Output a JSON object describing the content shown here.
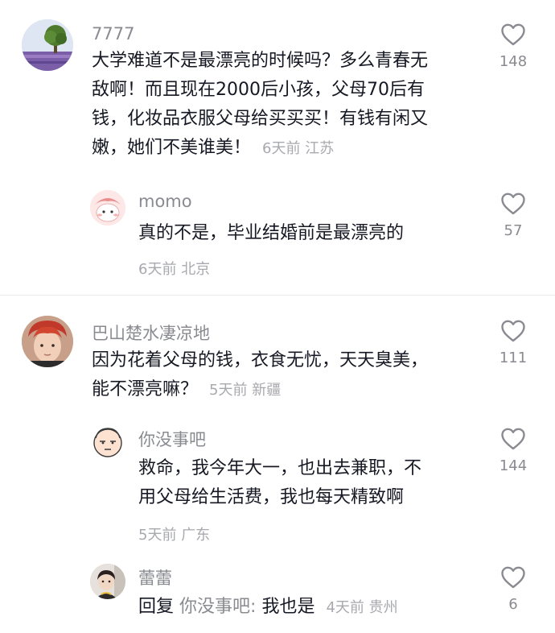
{
  "comments": [
    {
      "username": "7777",
      "text": "大学难道不是最漂亮的时候吗？多么青春无敌啊！而且现在2000后小孩，父母70后有钱，化妆品衣服父母给买买买！有钱有闲又嫩，她们不美谁美！",
      "text_lines": [
        "大学难道不是最漂亮的时候吗？多么青春无",
        "敌啊！而且现在2000后小孩，父母70后有",
        "钱，化妆品衣服父母给买买买！有钱有闲又",
        "嫩，她们不美谁美！"
      ],
      "time": "6天前",
      "location": "江苏",
      "likes": "148",
      "replies": [
        {
          "username": "momo",
          "text": "真的不是，毕业结婚前是最漂亮的",
          "time": "6天前",
          "location": "北京",
          "likes": "57"
        }
      ]
    },
    {
      "username": "巴山楚水凄凉地",
      "text_lines": [
        "因为花着父母的钱，衣食无忧，天天臭美，",
        "能不漂亮嘛？"
      ],
      "time": "5天前",
      "location": "新疆",
      "likes": "111",
      "replies": [
        {
          "username": "你没事吧",
          "text_lines": [
            "救命，我今年大一，也出去兼职，不",
            "用父母给生活费，我也每天精致啊"
          ],
          "time": "5天前",
          "location": "广东",
          "likes": "144"
        },
        {
          "username": "蕾蕾",
          "reply_prefix": "回复",
          "reply_target": "你没事吧:",
          "text": "我也是",
          "time": "4天前",
          "location": "贵州",
          "likes": "6"
        }
      ]
    }
  ],
  "colors": {
    "primary_text": "#161823",
    "secondary_text": "#8a8b91",
    "meta_text": "#a8a9ae",
    "divider": "#ebebeb"
  },
  "icons": {
    "like": "heart-outline-icon"
  }
}
